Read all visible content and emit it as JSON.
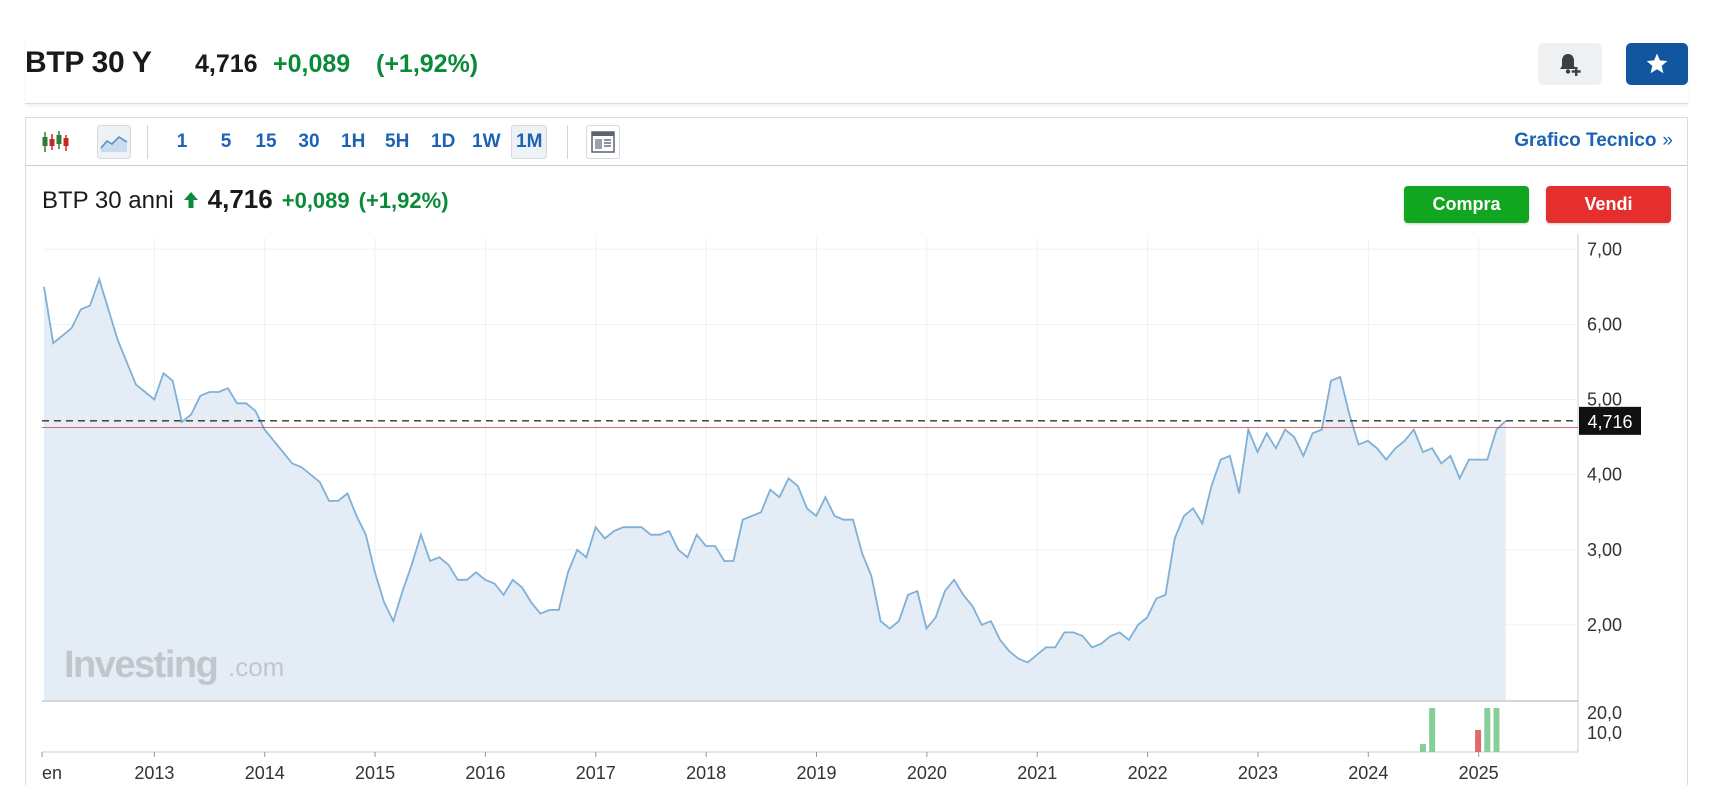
{
  "header": {
    "title": "BTP 30 Y",
    "price": "4,716",
    "change": "+0,089",
    "change_pct": "(+1,92%)"
  },
  "toolbar": {
    "timeframes": [
      "1",
      "5",
      "15",
      "30",
      "1H",
      "5H",
      "1D",
      "1W",
      "1M"
    ],
    "active_timeframe": "1M",
    "technical_link": "Grafico Tecnico",
    "technical_chevron": "»"
  },
  "instrument": {
    "name": "BTP 30 anni",
    "price": "4,716",
    "change": "+0,089",
    "change_pct": "(+1,92%)"
  },
  "actions": {
    "buy": "Compra",
    "sell": "Vendi"
  },
  "icons": {
    "alert": "bell-plus-icon",
    "favorite": "star-icon",
    "candles": "candlestick-icon",
    "area": "area-chart-icon",
    "layout": "layout-icon",
    "trend": "arrow-up-icon"
  },
  "colors": {
    "positive": "#0b8a3a",
    "negative": "#e52e2e",
    "accent": "#1256a0",
    "line": "#7eb0d8",
    "fill": "#e4edf5",
    "reference": "#d32f2f"
  },
  "watermark": {
    "brand": "Investing",
    "suffix": ".com"
  },
  "chart_data": {
    "type": "area",
    "x_axis_labels": [
      "en",
      "2013",
      "2014",
      "2015",
      "2016",
      "2017",
      "2018",
      "2019",
      "2020",
      "2021",
      "2022",
      "2023",
      "2024",
      "2025"
    ],
    "y_tick_labels": [
      "7,00",
      "6,00",
      "5,00",
      "4,00",
      "3,00",
      "2,00"
    ],
    "ylim": [
      1.0,
      7.15
    ],
    "x_start_year": 2012.0,
    "x_step_years": 0.0833,
    "current_value": 4.716,
    "current_value_label": "4,716",
    "previous_close": 4.627,
    "series": [
      {
        "values": [
          6.5,
          5.75,
          5.85,
          5.95,
          6.2,
          6.25,
          6.6,
          6.2,
          5.8,
          5.5,
          5.2,
          5.1,
          5.0,
          5.35,
          5.25,
          4.7,
          4.8,
          5.05,
          5.1,
          5.1,
          5.15,
          4.95,
          4.95,
          4.85,
          4.6,
          4.45,
          4.3,
          4.15,
          4.1,
          4.0,
          3.9,
          3.65,
          3.65,
          3.75,
          3.45,
          3.2,
          2.7,
          2.3,
          2.05,
          2.45,
          2.8,
          3.2,
          2.85,
          2.9,
          2.8,
          2.6,
          2.6,
          2.7,
          2.6,
          2.55,
          2.4,
          2.6,
          2.5,
          2.3,
          2.15,
          2.2,
          2.2,
          2.7,
          3.0,
          2.9,
          3.3,
          3.15,
          3.25,
          3.3,
          3.3,
          3.3,
          3.2,
          3.2,
          3.25,
          3.0,
          2.9,
          3.2,
          3.05,
          3.05,
          2.85,
          2.85,
          3.4,
          3.45,
          3.5,
          3.8,
          3.7,
          3.95,
          3.85,
          3.55,
          3.45,
          3.7,
          3.45,
          3.4,
          3.4,
          2.95,
          2.65,
          2.05,
          1.95,
          2.05,
          2.4,
          2.45,
          1.95,
          2.1,
          2.45,
          2.6,
          2.4,
          2.25,
          2.0,
          2.05,
          1.8,
          1.65,
          1.55,
          1.5,
          1.6,
          1.7,
          1.7,
          1.9,
          1.9,
          1.85,
          1.7,
          1.75,
          1.85,
          1.9,
          1.8,
          2.0,
          2.1,
          2.35,
          2.4,
          3.15,
          3.45,
          3.55,
          3.35,
          3.85,
          4.2,
          4.25,
          3.75,
          4.6,
          4.3,
          4.55,
          4.35,
          4.6,
          4.5,
          4.25,
          4.55,
          4.6,
          5.25,
          5.3,
          4.8,
          4.4,
          4.45,
          4.35,
          4.2,
          4.35,
          4.45,
          4.6,
          4.3,
          4.35,
          4.15,
          4.25,
          3.95,
          4.2,
          4.2,
          4.2,
          4.6,
          4.716
        ]
      }
    ],
    "volume": {
      "y_tick_labels": [
        "20,0",
        "10,0"
      ],
      "max": 25,
      "bars": [
        {
          "index": 150,
          "value": 4,
          "dir": "up"
        },
        {
          "index": 151,
          "value": 22,
          "dir": "up"
        },
        {
          "index": 156,
          "value": 11,
          "dir": "down"
        },
        {
          "index": 157,
          "value": 22,
          "dir": "up"
        },
        {
          "index": 158,
          "value": 22,
          "dir": "up"
        }
      ]
    }
  }
}
